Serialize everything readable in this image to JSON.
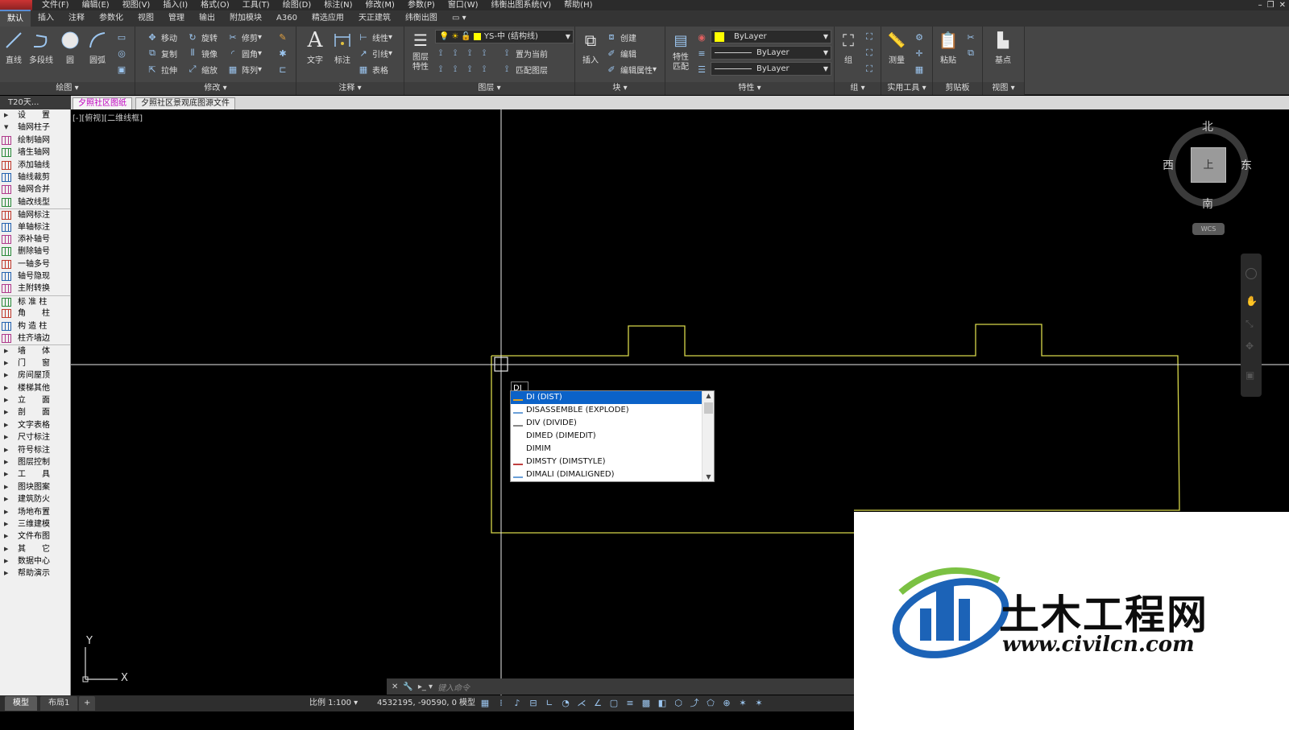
{
  "menubar": {
    "items": [
      "文件(F)",
      "编辑(E)",
      "视图(V)",
      "插入(I)",
      "格式(O)",
      "工具(T)",
      "绘图(D)",
      "标注(N)",
      "修改(M)",
      "参数(P)",
      "窗口(W)",
      "纬衡出图系统(V)",
      "帮助(H)"
    ]
  },
  "ribbon_tabs": [
    "默认",
    "插入",
    "注释",
    "参数化",
    "视图",
    "管理",
    "输出",
    "附加模块",
    "A360",
    "精选应用",
    "天正建筑",
    "纬衡出图"
  ],
  "ribbon": {
    "draw": {
      "title": "绘图",
      "line": "直线",
      "polyline": "多段线",
      "circle": "圆",
      "arc": "圆弧"
    },
    "modify": {
      "title": "修改",
      "move": "移动",
      "rotate": "旋转",
      "trim": "修剪",
      "copy": "复制",
      "mirror": "镜像",
      "fillet": "圆角",
      "stretch": "拉伸",
      "scale": "缩放",
      "array": "阵列"
    },
    "annotation": {
      "title": "注释",
      "text": "文字",
      "dim": "标注",
      "linear": "线性",
      "leader": "引线",
      "table": "表格"
    },
    "layers": {
      "title": "图层",
      "props": "图层\n特性",
      "layer_name": "YS-中 (结构线)",
      "set_current": "置为当前",
      "match": "匹配图层"
    },
    "block": {
      "title": "块",
      "insert": "插入",
      "create": "创建",
      "edit": "编辑",
      "edit_attr": "编辑属性"
    },
    "properties": {
      "title": "特性",
      "match": "特性\n匹配",
      "color": "ByLayer",
      "linetype": "ByLayer",
      "lineweight": "ByLayer",
      "accent": "#ffff00"
    },
    "groups": {
      "title": "组",
      "group": "组"
    },
    "utilities": {
      "title": "实用工具",
      "measure": "测量"
    },
    "clipboard": {
      "title": "剪贴板",
      "paste": "粘贴"
    },
    "view": {
      "title": "视图",
      "base": "基点"
    }
  },
  "doc_tabs": {
    "t20": "T20天...",
    "tab1": "夕照社区图纸",
    "tab2": "夕照社区景观底图源文件"
  },
  "sidebar": {
    "items": [
      {
        "label": "设　　置",
        "kind": "group"
      },
      {
        "label": "轴网柱子",
        "kind": "group-open"
      },
      {
        "label": "绘制轴网",
        "kind": "item"
      },
      {
        "label": "墙生轴网",
        "kind": "item"
      },
      {
        "label": "添加轴线",
        "kind": "item"
      },
      {
        "label": "轴线裁剪",
        "kind": "item"
      },
      {
        "label": "轴网合并",
        "kind": "item"
      },
      {
        "label": "轴改线型",
        "kind": "item"
      },
      {
        "label": "轴网标注",
        "kind": "item",
        "sep": true
      },
      {
        "label": "单轴标注",
        "kind": "item"
      },
      {
        "label": "添补轴号",
        "kind": "item"
      },
      {
        "label": "删除轴号",
        "kind": "item"
      },
      {
        "label": "一轴多号",
        "kind": "item"
      },
      {
        "label": "轴号隐现",
        "kind": "item"
      },
      {
        "label": "主附转换",
        "kind": "item"
      },
      {
        "label": "标 准 柱",
        "kind": "item",
        "sep": true
      },
      {
        "label": "角　　柱",
        "kind": "item"
      },
      {
        "label": "构 造 柱",
        "kind": "item"
      },
      {
        "label": "柱齐墙边",
        "kind": "item"
      },
      {
        "label": "墙　　体",
        "kind": "group",
        "sep": true
      },
      {
        "label": "门　　窗",
        "kind": "group"
      },
      {
        "label": "房间屋顶",
        "kind": "group"
      },
      {
        "label": "楼梯其他",
        "kind": "group"
      },
      {
        "label": "立　　面",
        "kind": "group"
      },
      {
        "label": "剖　　面",
        "kind": "group"
      },
      {
        "label": "文字表格",
        "kind": "group"
      },
      {
        "label": "尺寸标注",
        "kind": "group"
      },
      {
        "label": "符号标注",
        "kind": "group"
      },
      {
        "label": "图层控制",
        "kind": "group"
      },
      {
        "label": "工　　具",
        "kind": "group"
      },
      {
        "label": "图块图案",
        "kind": "group"
      },
      {
        "label": "建筑防火",
        "kind": "group"
      },
      {
        "label": "场地布置",
        "kind": "group"
      },
      {
        "label": "三维建模",
        "kind": "group"
      },
      {
        "label": "文件布图",
        "kind": "group"
      },
      {
        "label": "其　　它",
        "kind": "group"
      },
      {
        "label": "数据中心",
        "kind": "group"
      },
      {
        "label": "帮助演示",
        "kind": "group"
      }
    ]
  },
  "viewport": {
    "label": "[-][俯视][二维线框]",
    "dynamic_input": "DI"
  },
  "autocomplete": {
    "items": [
      "DI (DIST)",
      "DISASSEMBLE (EXPLODE)",
      "DIV (DIVIDE)",
      "DIMED (DIMEDIT)",
      "DIMIM",
      "DIMSTY (DIMSTYLE)",
      "DIMALI (DIMALIGNED)"
    ],
    "selected_index": 0
  },
  "viewcube": {
    "north": "北",
    "south": "南",
    "west": "西",
    "east": "东",
    "face": "上",
    "wcs": "WCS"
  },
  "ucs": {
    "x": "X",
    "y": "Y"
  },
  "command_line": {
    "prompt": "键入命令"
  },
  "statusbar": {
    "model_tab": "模型",
    "layout_tab": "布局1",
    "add": "+",
    "scale": "比例 1:100",
    "coords": "4532195, -90590, 0",
    "model": "模型"
  },
  "watermark": {
    "title": "土木工程网",
    "url": "www.civilcn.com"
  },
  "colors": {
    "drawing_line": "#d7d74a",
    "crosshair": "#e8e8e8",
    "selection": "#0b62c8"
  }
}
